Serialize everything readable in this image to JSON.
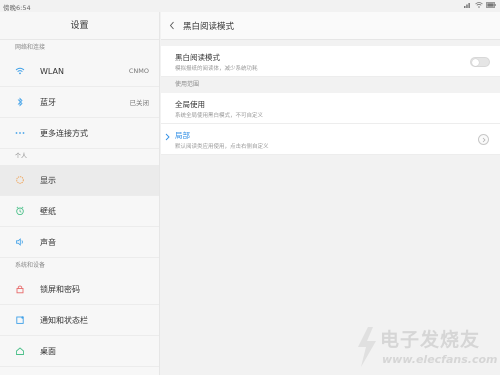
{
  "status": {
    "time": "傍晚6:54"
  },
  "sidebar": {
    "title": "设置",
    "sections": [
      {
        "label": "网络和连接"
      },
      {
        "label": "个人"
      },
      {
        "label": "系统和设备"
      }
    ],
    "items": [
      {
        "label": "WLAN",
        "value": "CNMO",
        "icon": "wifi-icon"
      },
      {
        "label": "蓝牙",
        "value": "已关闭",
        "icon": "bluetooth-icon"
      },
      {
        "label": "更多连接方式",
        "icon": "more-dots-icon"
      },
      {
        "label": "显示",
        "icon": "display-icon"
      },
      {
        "label": "壁纸",
        "icon": "wallpaper-icon"
      },
      {
        "label": "声音",
        "icon": "sound-icon"
      },
      {
        "label": "锁屏和密码",
        "icon": "lock-icon"
      },
      {
        "label": "通知和状态栏",
        "icon": "notification-icon"
      },
      {
        "label": "桌面",
        "icon": "desktop-icon"
      }
    ]
  },
  "detail": {
    "title": "黑白阅读模式",
    "mode_option": {
      "title": "黑白阅读模式",
      "subtitle": "模拟报纸的阅读体，减少系统功耗",
      "enabled": false
    },
    "scope_header": "使用范围",
    "global_option": {
      "title": "全局使用",
      "subtitle": "系统全局使用黑白模式，不可自定义"
    },
    "local_option": {
      "title": "局部",
      "subtitle": "默认阅读类应用使用，点击右侧自定义"
    }
  },
  "colors": {
    "accent": "#2f8ee5",
    "active_row": "#ebebeb"
  },
  "watermark": {
    "cn": "电子发烧友",
    "en": "www.elecfans.com"
  }
}
